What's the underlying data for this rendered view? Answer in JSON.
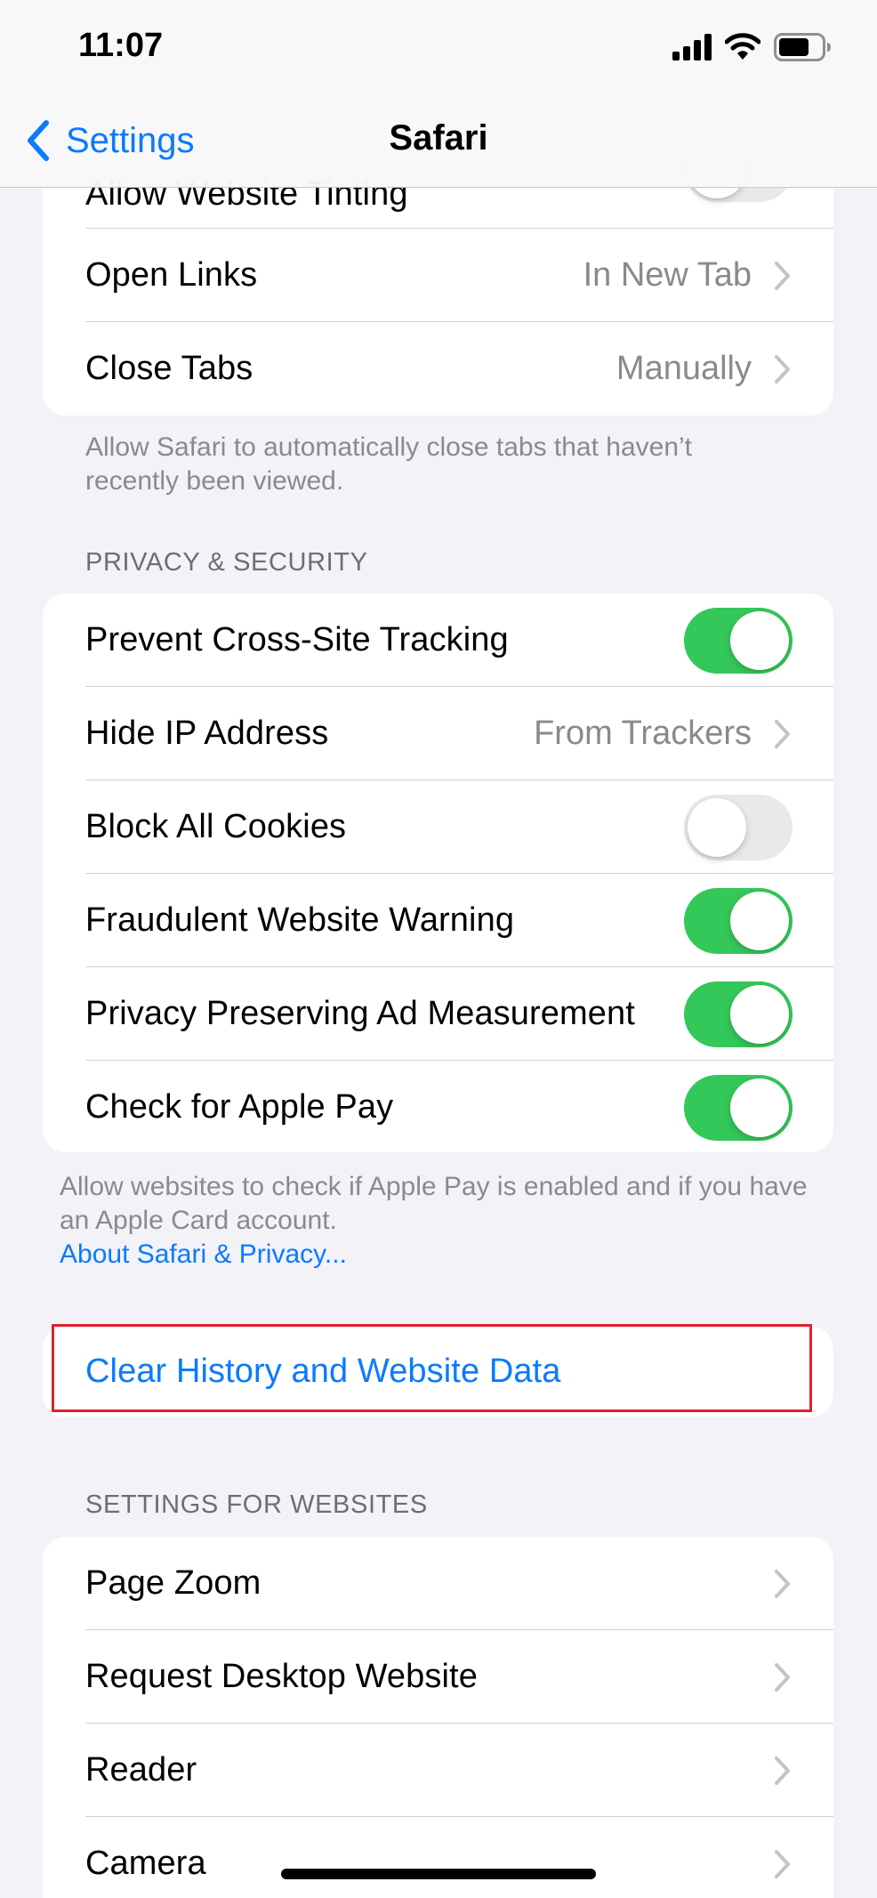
{
  "status_bar": {
    "time": "11:07"
  },
  "nav": {
    "back_label": "Settings",
    "title": "Safari"
  },
  "tabs_group": {
    "partial_row": {
      "label": "Allow Website Tinting",
      "toggle_on": false
    },
    "open_links": {
      "label": "Open Links",
      "value": "In New Tab"
    },
    "close_tabs": {
      "label": "Close Tabs",
      "value": "Manually"
    }
  },
  "tabs_footer": "Allow Safari to automatically close tabs that haven’t recently been viewed.",
  "privacy": {
    "header": "PRIVACY & SECURITY",
    "rows": [
      {
        "label": "Prevent Cross-Site Tracking",
        "toggle_on": true
      },
      {
        "label": "Hide IP Address",
        "value": "From Trackers"
      },
      {
        "label": "Block All Cookies",
        "toggle_on": false
      },
      {
        "label": "Fraudulent Website Warning",
        "toggle_on": true
      },
      {
        "label": "Privacy Preserving Ad Measurement",
        "toggle_on": true
      },
      {
        "label": "Check for Apple Pay",
        "toggle_on": true
      }
    ],
    "footer": "Allow websites to check if Apple Pay is enabled and if you have an Apple Card account.",
    "footer_link": "About Safari & Privacy..."
  },
  "clear_history": {
    "label": "Clear History and Website Data"
  },
  "websites": {
    "header": "SETTINGS FOR WEBSITES",
    "rows": [
      {
        "label": "Page Zoom"
      },
      {
        "label": "Request Desktop Website"
      },
      {
        "label": "Reader"
      },
      {
        "label": "Camera"
      }
    ]
  },
  "colors": {
    "accent": "#0a7aff",
    "toggle_on": "#34c759",
    "highlight": "#e0202e"
  }
}
